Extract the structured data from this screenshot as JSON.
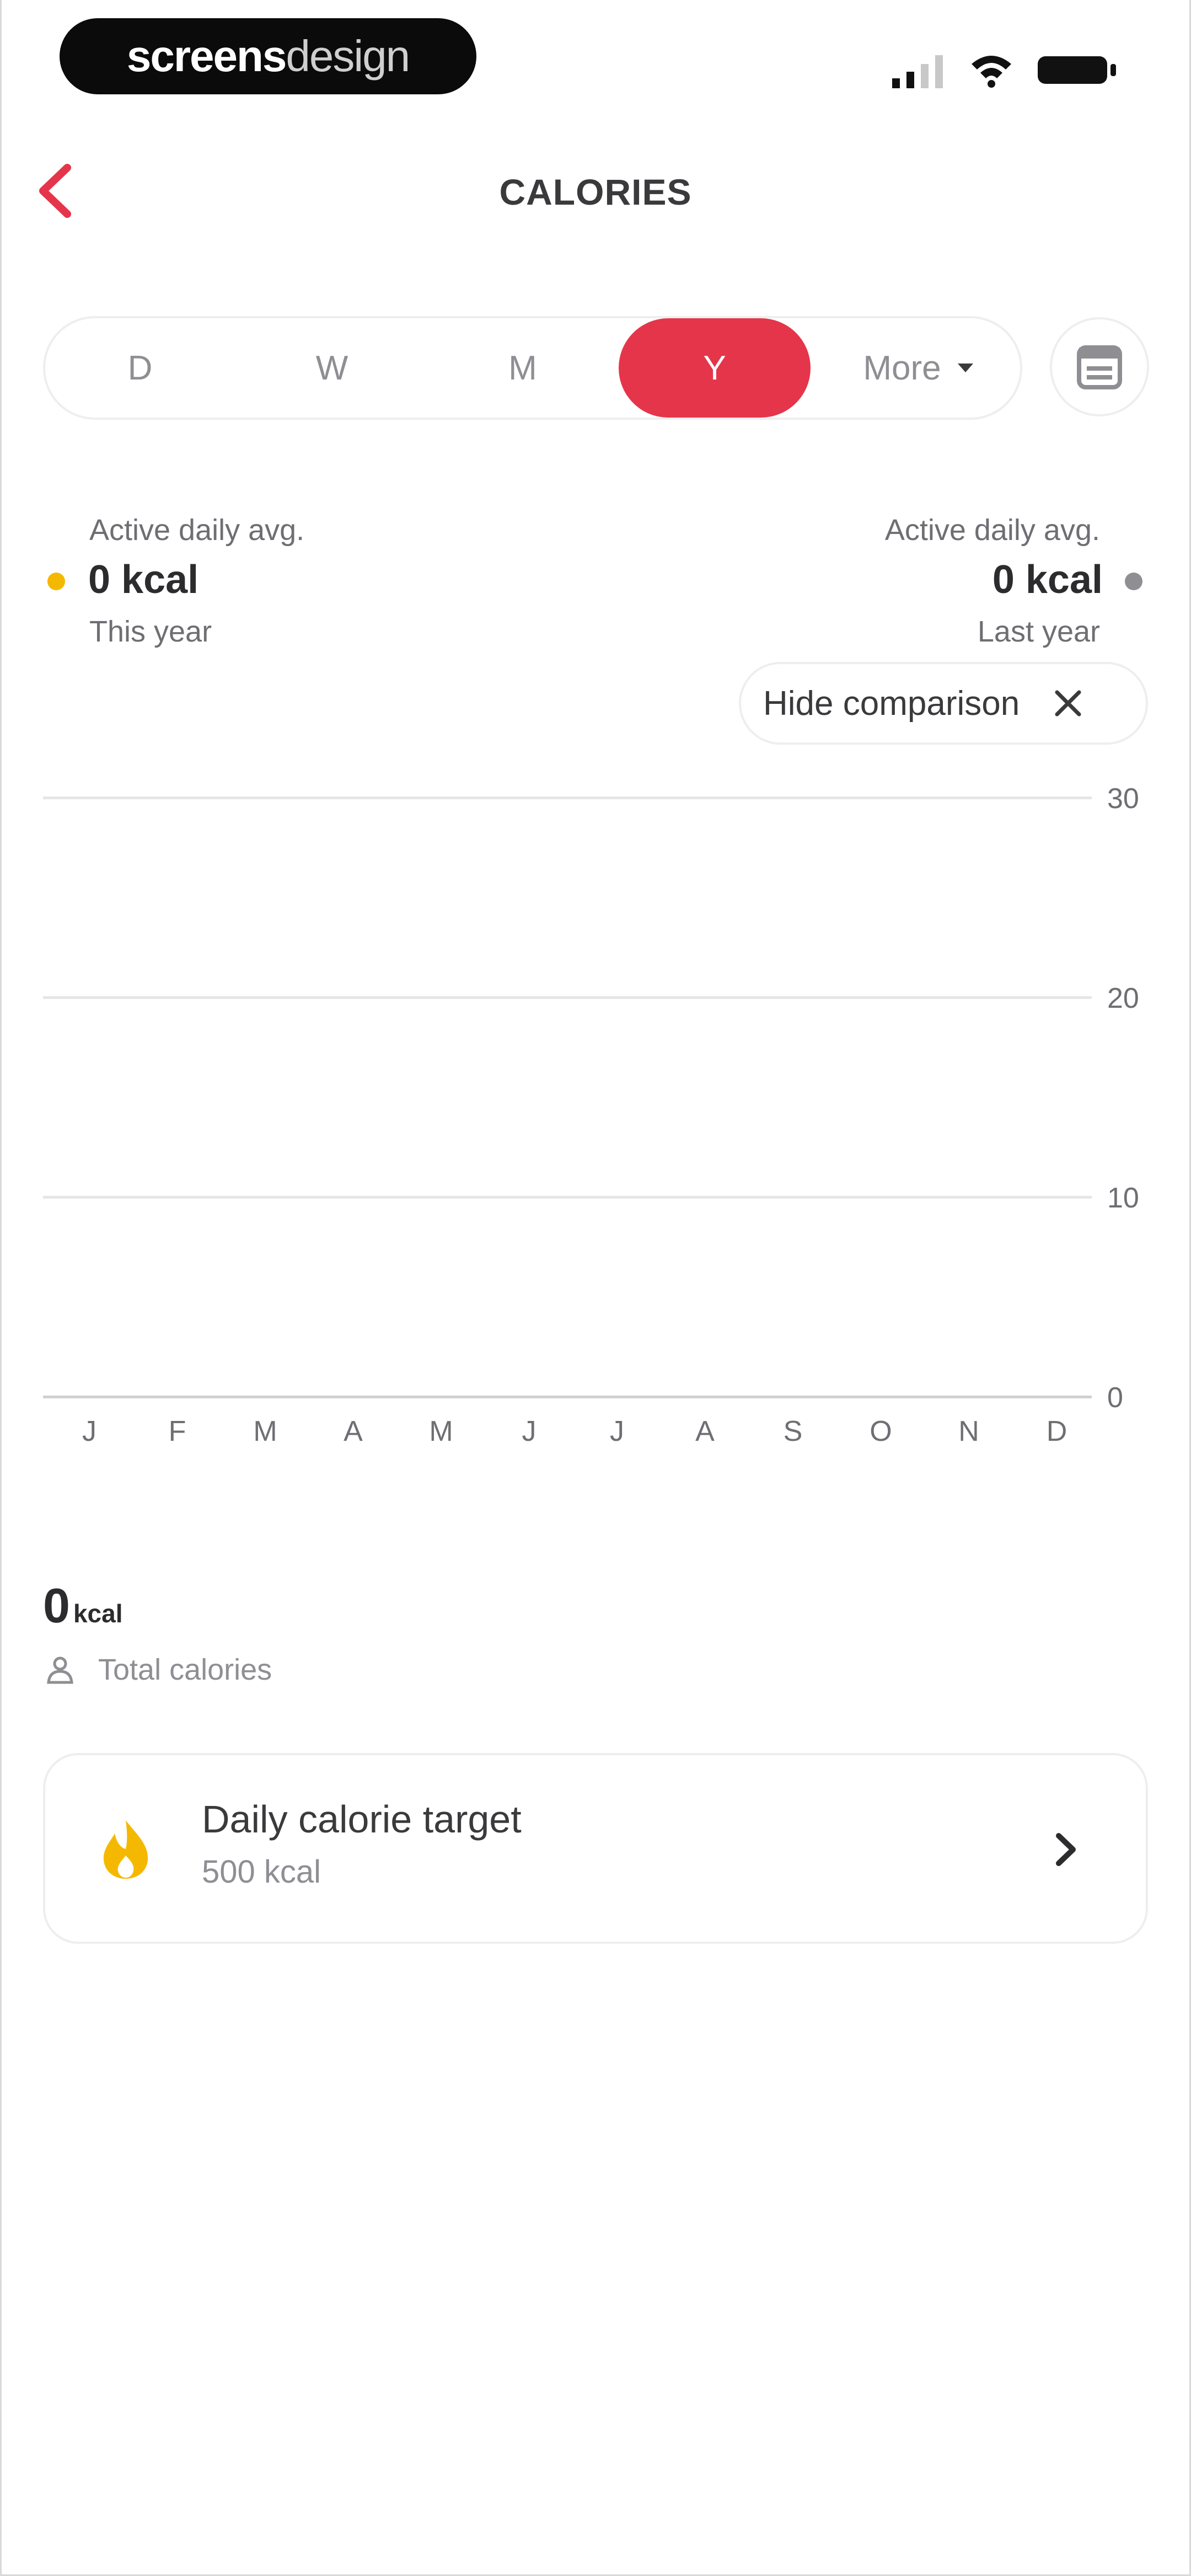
{
  "brand": {
    "part1": "screens",
    "part2": "design"
  },
  "header": {
    "title": "CALORIES"
  },
  "segments": {
    "items": [
      "D",
      "W",
      "M",
      "Y"
    ],
    "more_label": "More",
    "active": "Y"
  },
  "stats": {
    "this_year": {
      "label": "Active daily avg.",
      "value": "0 kcal",
      "period": "This year"
    },
    "last_year": {
      "label": "Active daily avg.",
      "value": "0 kcal",
      "period": "Last year"
    }
  },
  "comparison_chip": {
    "label": "Hide comparison"
  },
  "chart_data": {
    "type": "bar",
    "categories": [
      "J",
      "F",
      "M",
      "A",
      "M",
      "J",
      "J",
      "A",
      "S",
      "O",
      "N",
      "D"
    ],
    "series": [
      {
        "values": [
          0,
          0,
          0,
          0,
          0,
          0,
          0,
          0,
          0,
          0,
          0,
          0
        ]
      },
      {
        "values": [
          0,
          0,
          0,
          0,
          0,
          0,
          0,
          0,
          0,
          0,
          0,
          0
        ]
      }
    ],
    "y_ticks": [
      "30",
      "20",
      "10",
      "0"
    ],
    "ylim": [
      0,
      30
    ],
    "grid": true
  },
  "totals": {
    "value": "0",
    "unit": "kcal",
    "label": "Total calories"
  },
  "target_card": {
    "title": "Daily calorie target",
    "value": "500 kcal"
  },
  "colors": {
    "accent": "#e5354a",
    "this_year_dot": "#f5b800",
    "last_year_dot": "#8e8e93",
    "flame": "#f5b800"
  }
}
